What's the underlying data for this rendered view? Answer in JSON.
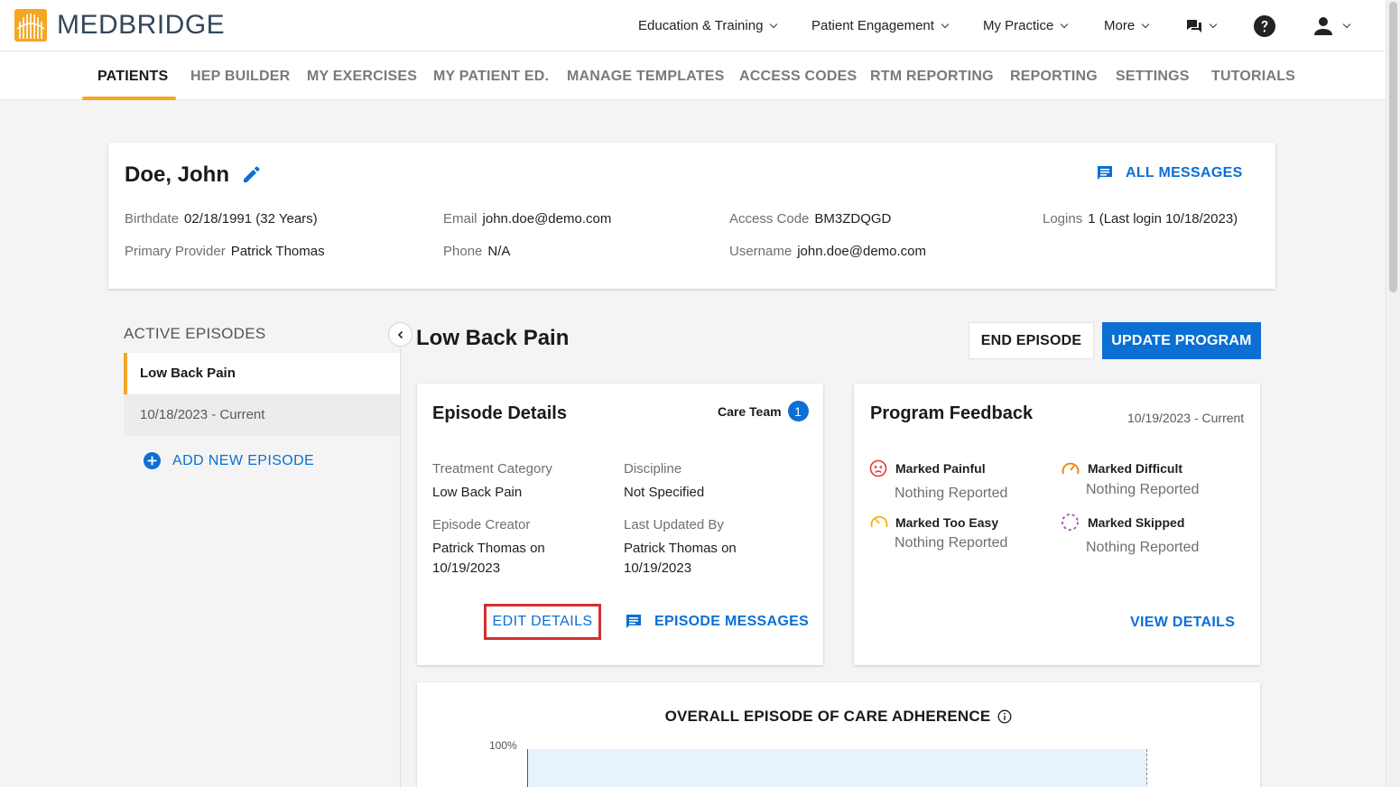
{
  "app": {
    "logo_text": "MEDBRIDGE",
    "accent_color": "#0b6fd4",
    "active_tab_color": "#f5a623"
  },
  "topnav": {
    "education": "Education & Training",
    "engagement": "Patient Engagement",
    "practice": "My Practice",
    "more": "More"
  },
  "tabs": [
    "PATIENTS",
    "HEP BUILDER",
    "MY EXERCISES",
    "MY PATIENT ED.",
    "MANAGE TEMPLATES",
    "ACCESS CODES",
    "RTM REPORTING",
    "REPORTING",
    "SETTINGS",
    "TUTORIALS"
  ],
  "patient": {
    "name": "Doe, John",
    "all_messages": "ALL MESSAGES",
    "birthdate_label": "Birthdate",
    "birthdate": "02/18/1991 (32 Years)",
    "email_label": "Email",
    "email": "john.doe@demo.com",
    "access_code_label": "Access Code",
    "access_code": "BM3ZDQGD",
    "logins_label": "Logins",
    "logins": "1 (Last login 10/18/2023)",
    "provider_label": "Primary Provider",
    "provider": "Patrick Thomas",
    "phone_label": "Phone",
    "phone": "N/A",
    "username_label": "Username",
    "username": "john.doe@demo.com"
  },
  "episodes": {
    "title": "ACTIVE EPISODES",
    "current_name": "Low Back Pain",
    "current_dates": "10/18/2023 - Current",
    "add_new": "ADD NEW EPISODE"
  },
  "episode": {
    "title": "Low Back Pain",
    "end_button": "END EPISODE",
    "update_button": "UPDATE PROGRAM"
  },
  "details": {
    "title": "Episode Details",
    "care_team_label": "Care Team",
    "care_team_count": "1",
    "treatment_label": "Treatment Category",
    "treatment": "Low Back Pain",
    "discipline_label": "Discipline",
    "discipline": "Not Specified",
    "creator_label": "Episode Creator",
    "creator_line1": "Patrick Thomas on",
    "creator_line2": "10/19/2023",
    "updated_label": "Last Updated By",
    "updated_line1": "Patrick Thomas on",
    "updated_line2": "10/19/2023",
    "edit_details": "EDIT DETAILS",
    "episode_messages": "EPISODE MESSAGES"
  },
  "feedback": {
    "title": "Program Feedback",
    "dates": "10/19/2023 - Current",
    "painful_label": "Marked Painful",
    "painful_value": "Nothing Reported",
    "difficult_label": "Marked Difficult",
    "difficult_value": "Nothing Reported",
    "easy_label": "Marked Too Easy",
    "easy_value": "Nothing Reported",
    "skipped_label": "Marked Skipped",
    "skipped_value": "Nothing Reported",
    "view_details": "VIEW DETAILS"
  },
  "adherence": {
    "title": "OVERALL EPISODE OF CARE ADHERENCE",
    "y_tick": "100%"
  }
}
